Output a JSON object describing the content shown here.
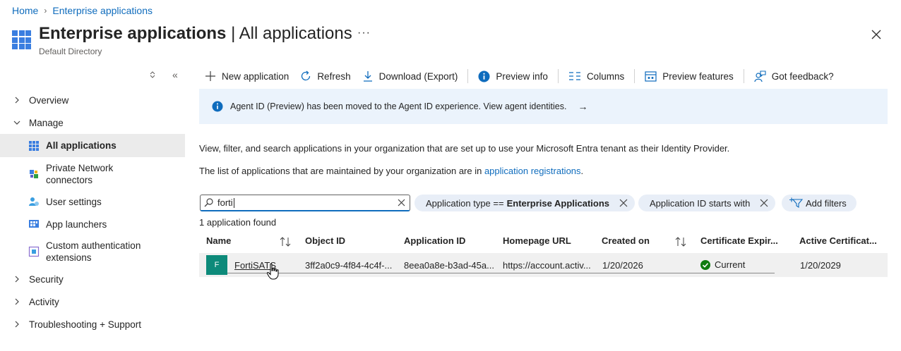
{
  "breadcrumb": {
    "home": "Home",
    "current": "Enterprise applications"
  },
  "header": {
    "title_main": "Enterprise applications",
    "title_separator": " | ",
    "title_section": "All applications",
    "more": "···",
    "subtitle": "Default Directory"
  },
  "sidebar": {
    "overview": "Overview",
    "manage": "Manage",
    "manage_items": [
      {
        "label": "All applications",
        "active": true
      },
      {
        "label_line1": "Private Network",
        "label_line2": "connectors"
      },
      {
        "label": "User settings"
      },
      {
        "label": "App launchers"
      },
      {
        "label_line1": "Custom authentication",
        "label_line2": "extensions"
      }
    ],
    "security": "Security",
    "activity": "Activity",
    "troubleshooting": "Troubleshooting + Support"
  },
  "toolbar": {
    "new_application": "New application",
    "refresh": "Refresh",
    "download": "Download (Export)",
    "preview_info": "Preview info",
    "columns": "Columns",
    "preview_features": "Preview features",
    "feedback": "Got feedback?"
  },
  "banner": {
    "text": "Agent ID (Preview) has been moved to the Agent ID experience. View agent identities.",
    "arrow": "→"
  },
  "description": {
    "line1": "View, filter, and search applications in your organization that are set up to use your Microsoft Entra tenant as their Identity Provider.",
    "line2_prefix": "The list of applications that are maintained by your organization are in ",
    "line2_link": "application registrations",
    "line2_suffix": "."
  },
  "search": {
    "value": "forti"
  },
  "filters": {
    "app_type_prefix": "Application type == ",
    "app_type_value": "Enterprise Applications",
    "app_id": "Application ID starts with",
    "add": "Add filters"
  },
  "results": {
    "count_text": "1 application found"
  },
  "table": {
    "headers": {
      "name": "Name",
      "object_id": "Object ID",
      "application_id": "Application ID",
      "homepage_url": "Homepage URL",
      "created_on": "Created on",
      "cert_expiry": "Certificate Expir...",
      "active_cert": "Active Certificat..."
    },
    "rows": [
      {
        "avatar": "F",
        "name": "FortiSATS",
        "object_id": "3ff2a0c9-4f84-4c4f-...",
        "application_id": "8eea0a8e-b3ad-45a...",
        "homepage_url": "https://account.activ...",
        "created_on": "1/20/2026",
        "cert_status": "Current",
        "active_cert": "1/20/2029"
      }
    ]
  },
  "colors": {
    "link": "#0f6cbd",
    "accent": "#3a7ee0",
    "avatar_bg": "#0d8a7a",
    "success": "#107c10",
    "banner_bg": "#ebf3fc"
  }
}
